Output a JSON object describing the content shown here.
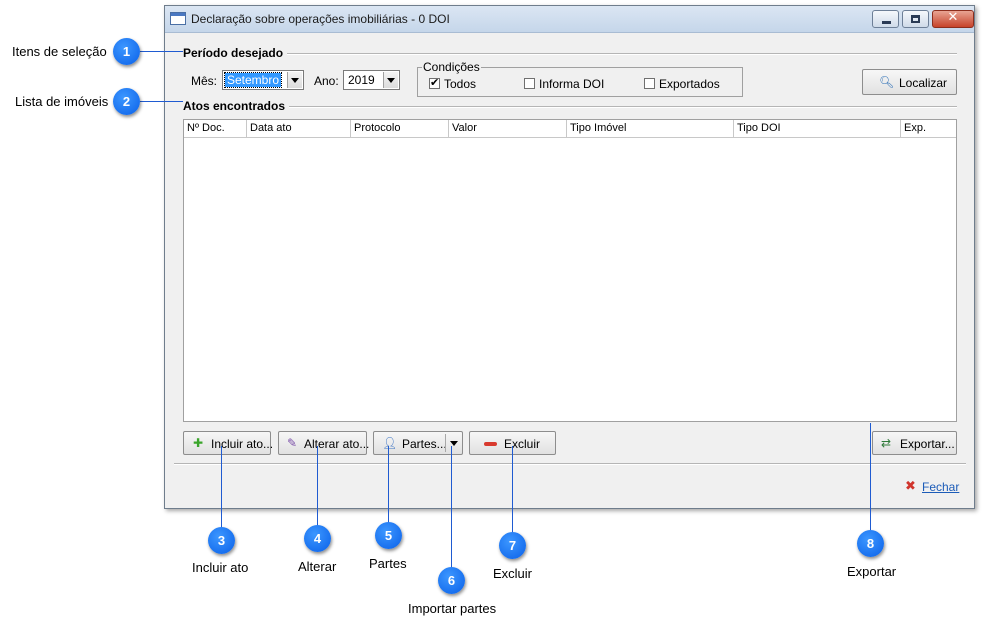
{
  "window": {
    "title": "Declaração sobre operações imobiliárias - 0 DOI",
    "close_glyph": "✕"
  },
  "periodo": {
    "label": "Período desejado",
    "mes_label": "Mês:",
    "mes_value": "Setembro",
    "ano_label": "Ano:",
    "ano_value": "2019"
  },
  "condicoes": {
    "label": "Condições",
    "options": [
      {
        "label": "Todos",
        "checked": true
      },
      {
        "label": "Informa DOI",
        "checked": false
      },
      {
        "label": "Exportados",
        "checked": false
      }
    ]
  },
  "localizar_label": "Localizar",
  "atos": {
    "label": "Atos encontrados",
    "columns": [
      "Nº Doc.",
      "Data ato",
      "Protocolo",
      "Valor",
      "Tipo Imóvel",
      "Tipo DOI",
      "Exp."
    ]
  },
  "buttons": {
    "incluir": "Incluir ato...",
    "alterar": "Alterar ato...",
    "partes": "Partes...",
    "excluir": "Excluir",
    "exportar": "Exportar...",
    "fechar": "Fechar"
  },
  "callouts": [
    {
      "number": "1",
      "text": "Itens de seleção"
    },
    {
      "number": "2",
      "text": "Lista de imóveis"
    },
    {
      "number": "3",
      "text": "Incluir ato"
    },
    {
      "number": "4",
      "text": "Alterar"
    },
    {
      "number": "5",
      "text": "Partes"
    },
    {
      "number": "6",
      "text": "Importar partes"
    },
    {
      "number": "7",
      "text": "Excluir"
    },
    {
      "number": "8",
      "text": "Exportar"
    }
  ],
  "colors": {
    "badge": "#1a73f0",
    "callout_line": "#1f5bd1",
    "link": "#1c5cb8"
  }
}
